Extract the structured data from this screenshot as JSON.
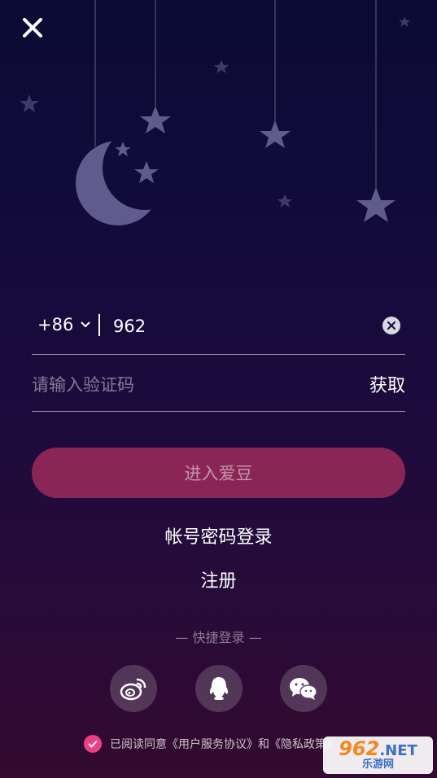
{
  "phone": {
    "country_code": "+86",
    "value": "962"
  },
  "code": {
    "placeholder": "请输入验证码",
    "get_label": "获取"
  },
  "enter_label": "进入爱豆",
  "account_login_label": "帐号密码登录",
  "register_label": "注册",
  "quick_login_title": "—  快捷登录  —",
  "social_icons": [
    "weibo-icon",
    "qq-icon",
    "wechat-icon"
  ],
  "agreement": {
    "prefix": "已阅读同意",
    "user_agreement": "《用户服务协议》",
    "and": "和",
    "privacy_policy": "《隐私政策》"
  },
  "watermark": {
    "number": "962",
    "suffix": ".NET",
    "subtitle": "乐游网"
  },
  "colors": {
    "primary_button": "#8a2656",
    "checkbox": "#ec3f84",
    "watermark_orange": "#f5861f"
  }
}
